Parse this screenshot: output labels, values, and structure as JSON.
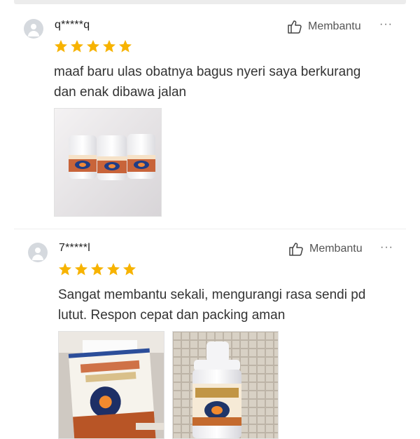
{
  "reviews": [
    {
      "username": "q*****q",
      "helpful_label": "Membantu",
      "more_label": "···",
      "rating": 5,
      "comment_lines": [
        "maaf baru ulas obatnya bagus nyeri saya berkurang",
        "dan enak dibawa jalan"
      ],
      "photos": [
        "three-bottles-photo"
      ]
    },
    {
      "username": "7*****l",
      "helpful_label": "Membantu",
      "more_label": "···",
      "rating": 5,
      "comment_lines": [
        "Sangat membantu sekali, mengurangi rasa sendi pd",
        "lutut. Respon cepat dan packing aman"
      ],
      "photos": [
        "product-box-photo",
        "single-bottle-photo"
      ]
    }
  ],
  "colors": {
    "star": "#f7b300",
    "text": "#333333",
    "muted": "#555555"
  }
}
